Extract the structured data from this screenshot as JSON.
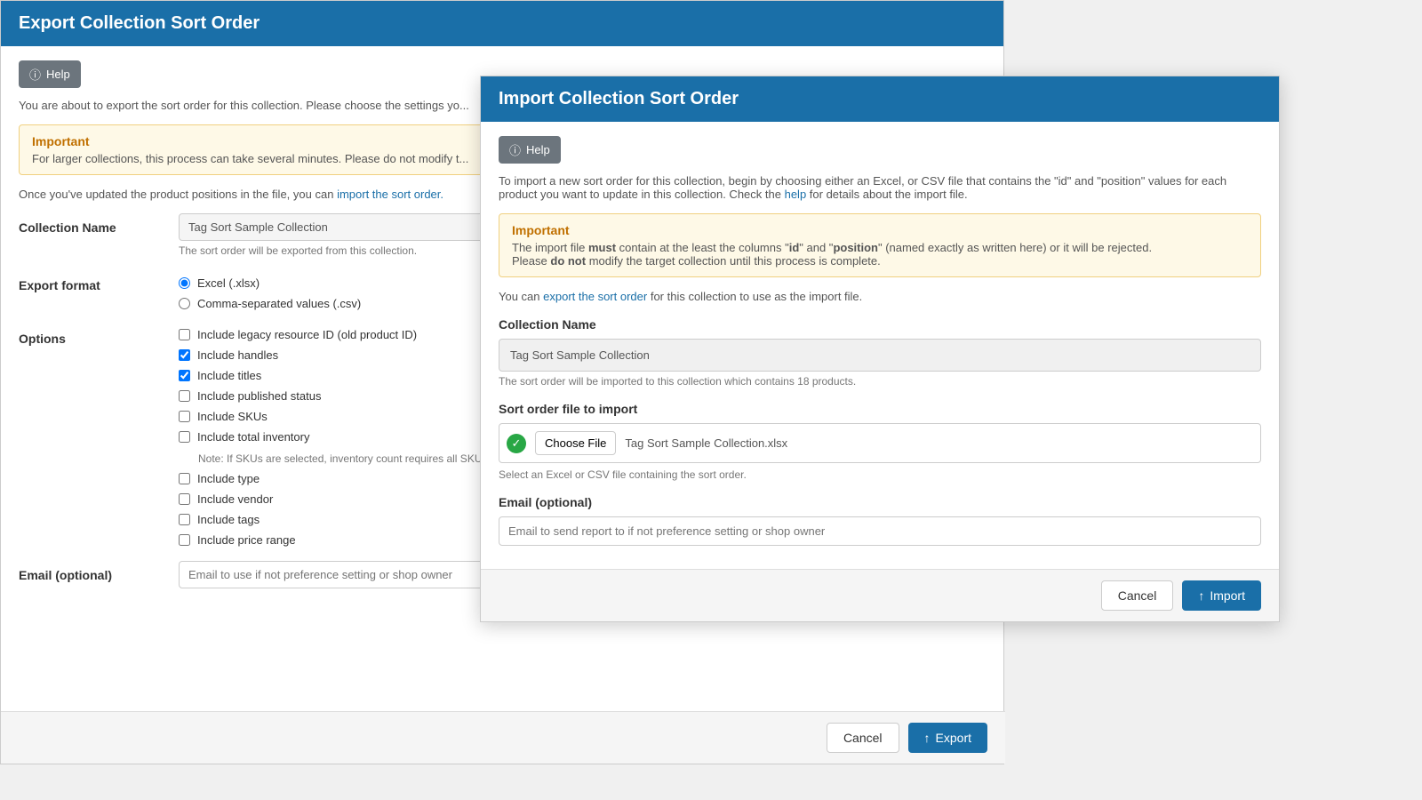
{
  "export": {
    "header": "Export Collection Sort Order",
    "help_label": "Help",
    "description": "You are about to export the sort order for this collection. Please choose the settings yo...",
    "important_title": "Important",
    "important_text": "For larger collections, this process can take several minutes. Please do not modify t...",
    "import_link": "import the sort order.",
    "once_text": "Once you've updated the product positions in the file, you can",
    "collection_name_label": "Collection Name",
    "collection_name_value": "Tag Sort Sample Collection",
    "collection_name_hint": "The sort order will be exported from this collection.",
    "export_format_label": "Export format",
    "format_excel": "Excel (.xlsx)",
    "format_csv": "Comma-separated values (.csv)",
    "options_label": "Options",
    "option_legacy": "Include legacy resource ID (old product ID)",
    "option_handles": "Include handles",
    "option_titles": "Include titles",
    "option_published": "Include published status",
    "option_skus": "Include SKUs",
    "option_inventory": "Include total inventory",
    "inventory_note": "Note: If SKUs are selected, inventory count requires all SKUs to...",
    "option_type": "Include type",
    "option_vendor": "Include vendor",
    "option_tags": "Include tags",
    "option_price_range": "Include price range",
    "email_label": "Email (optional)",
    "email_placeholder": "Email to use if not preference setting or shop owner",
    "cancel_label": "Cancel",
    "export_label": "Export"
  },
  "import": {
    "header": "Import Collection Sort Order",
    "help_label": "Help",
    "description_start": "To import a new sort order for this collection, begin by choosing either an Excel, or CSV file that contains the \"id\" and \"position\" values for each product you want to update in this collection. Check the",
    "help_link": "help",
    "description_end": "for details about the import file.",
    "important_title": "Important",
    "important_line1_start": "The import file",
    "important_must": "must",
    "important_line1_mid": "contain at the least the columns \"",
    "important_id": "id",
    "important_line1_mid2": "\" and \"",
    "important_position": "position",
    "important_line1_end": "\" (named exactly as written here) or it will be rejected.",
    "important_line2_start": "Please",
    "important_do_not": "do not",
    "important_line2_end": "modify the target collection until this process is complete.",
    "export_link": "export the sort order",
    "can_export_text_start": "You can",
    "can_export_text_end": "for this collection to use as the import file.",
    "collection_name_label": "Collection Name",
    "collection_name_value": "Tag Sort Sample Collection",
    "collection_hint": "The sort order will be imported to this collection which contains 18 products.",
    "sort_file_label": "Sort order file to import",
    "file_name": "Tag Sort Sample Collection.xlsx",
    "file_hint": "Select an Excel or CSV file containing the sort order.",
    "choose_file_label": "Choose File",
    "email_label": "Email (optional)",
    "email_placeholder": "Email to send report to if not preference setting or shop owner",
    "cancel_label": "Cancel",
    "import_label": "Import"
  },
  "icons": {
    "help": "?",
    "upload": "↑",
    "check": "✓"
  }
}
